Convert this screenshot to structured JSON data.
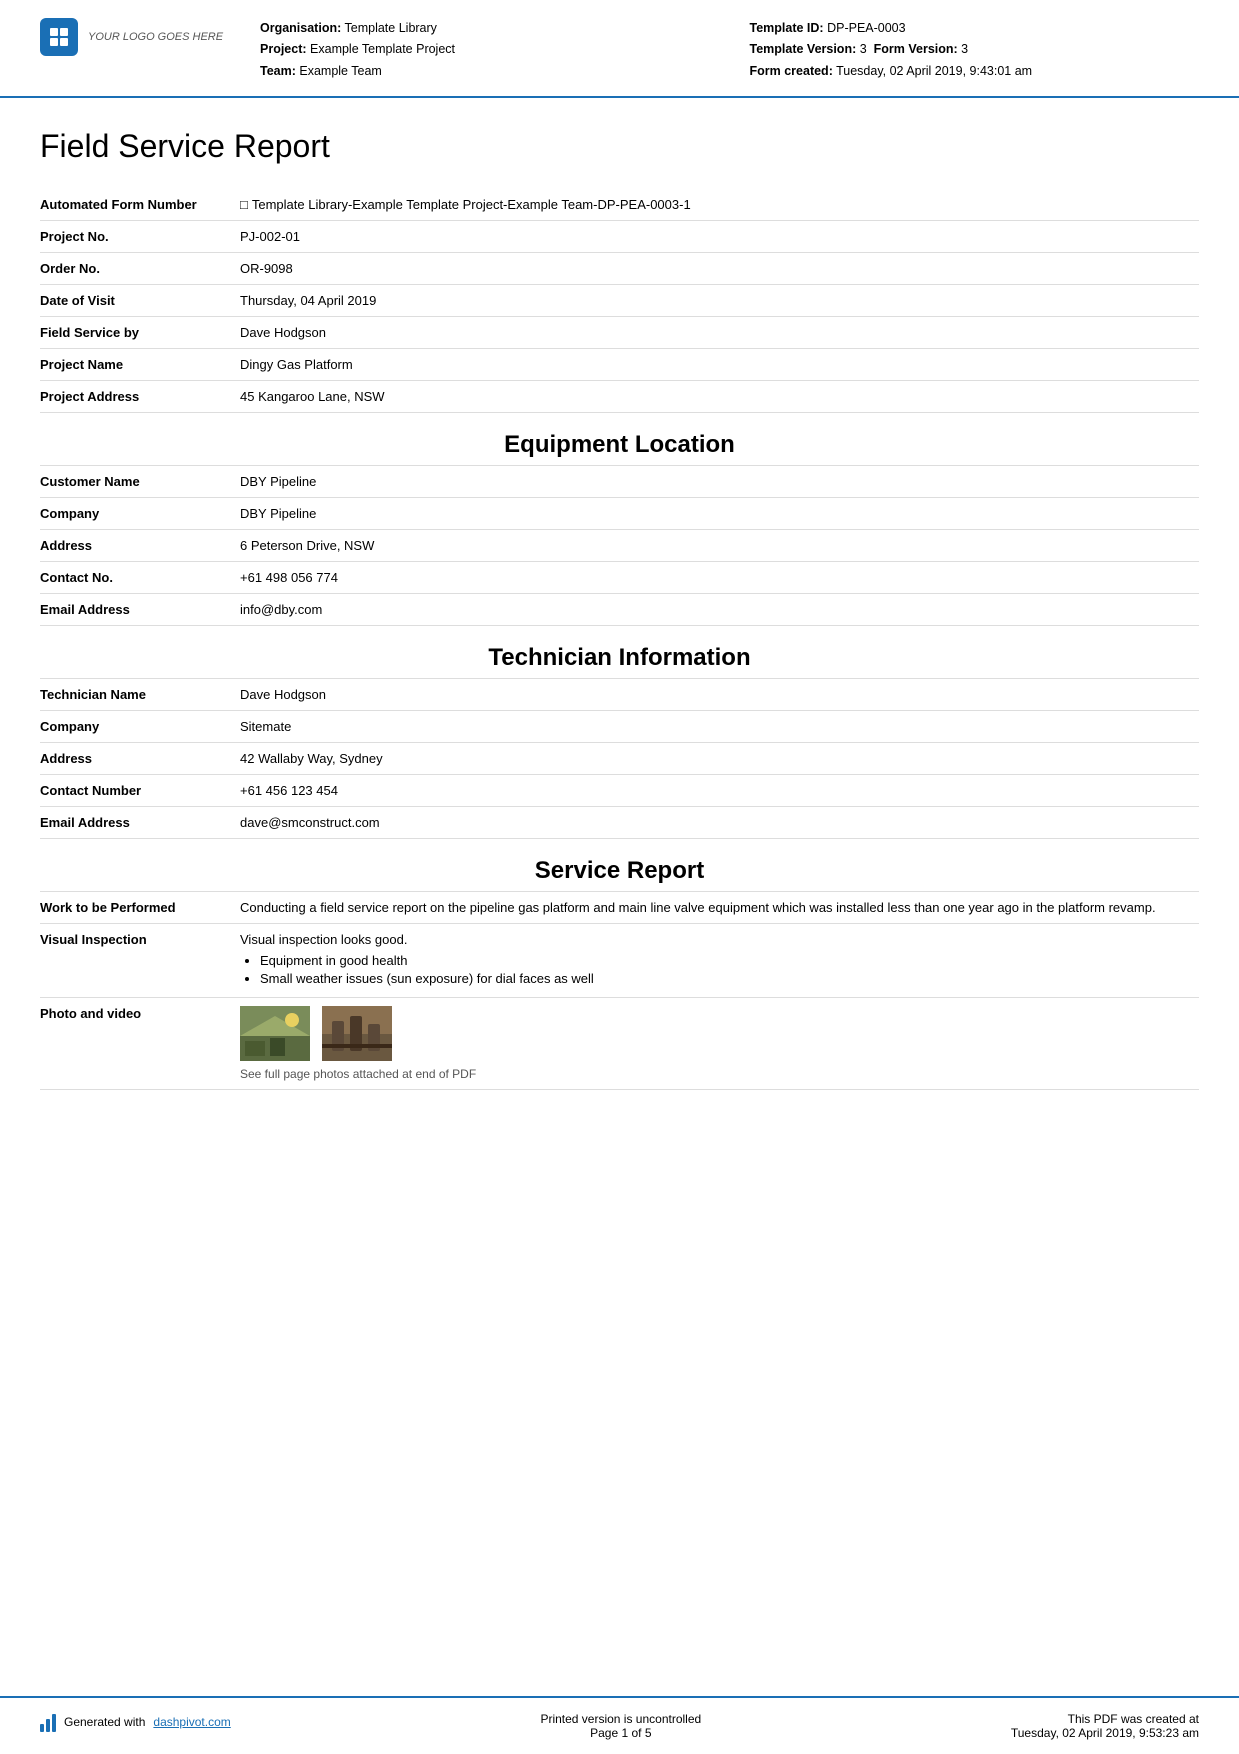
{
  "header": {
    "logo_alt": "YOUR LOGO GOES HERE",
    "org_label": "Organisation:",
    "org_value": "Template Library",
    "project_label": "Project:",
    "project_value": "Example Template Project",
    "team_label": "Team:",
    "team_value": "Example Team",
    "template_id_label": "Template ID:",
    "template_id_value": "DP-PEA-0003",
    "template_version_label": "Template Version:",
    "template_version_value": "3",
    "form_version_label": "Form Version:",
    "form_version_value": "3",
    "form_created_label": "Form created:",
    "form_created_value": "Tuesday, 02 April 2019, 9:43:01 am"
  },
  "page_title": "Field Service Report",
  "form_info": {
    "automated_form_number_label": "Automated Form Number",
    "automated_form_number_value": "Template Library-Example Template Project-Example Team-DP-PEA-0003-1",
    "project_no_label": "Project No.",
    "project_no_value": "PJ-002-01",
    "order_no_label": "Order No.",
    "order_no_value": "OR-9098",
    "date_of_visit_label": "Date of Visit",
    "date_of_visit_value": "Thursday, 04 April 2019",
    "field_service_by_label": "Field Service by",
    "field_service_by_value": "Dave Hodgson",
    "project_name_label": "Project Name",
    "project_name_value": "Dingy Gas Platform",
    "project_address_label": "Project Address",
    "project_address_value": "45 Kangaroo Lane, NSW"
  },
  "equipment_location": {
    "heading": "Equipment Location",
    "customer_name_label": "Customer Name",
    "customer_name_value": "DBY Pipeline",
    "company_label": "Company",
    "company_value": "DBY Pipeline",
    "address_label": "Address",
    "address_value": "6 Peterson Drive, NSW",
    "contact_no_label": "Contact No.",
    "contact_no_value": "+61 498 056 774",
    "email_address_label": "Email Address",
    "email_address_value": "info@dby.com"
  },
  "technician_information": {
    "heading": "Technician Information",
    "technician_name_label": "Technician Name",
    "technician_name_value": "Dave Hodgson",
    "company_label": "Company",
    "company_value": "Sitemate",
    "address_label": "Address",
    "address_value": "42 Wallaby Way, Sydney",
    "contact_number_label": "Contact Number",
    "contact_number_value": "+61 456 123 454",
    "email_address_label": "Email Address",
    "email_address_value": "dave@smconstruct.com"
  },
  "service_report": {
    "heading": "Service Report",
    "work_label": "Work to be Performed",
    "work_value": "Conducting a field service report on the pipeline gas platform and main line valve equipment which was installed less than one year ago in the platform revamp.",
    "visual_inspection_label": "Visual Inspection",
    "visual_inspection_intro": "Visual inspection looks good.",
    "visual_inspection_bullets": [
      "Equipment in good health",
      "Small weather issues (sun exposure) for dial faces as well"
    ],
    "photo_label": "Photo and video",
    "photo_note": "See full page photos attached at end of PDF"
  },
  "footer": {
    "generated_with_prefix": "Generated with ",
    "generated_with_link": "dashpivot.com",
    "printed_version": "Printed version is uncontrolled",
    "page_of": "Page 1 of 5",
    "pdf_created_prefix": "This PDF was created at",
    "pdf_created_value": "Tuesday, 02 April 2019, 9:53:23 am"
  }
}
